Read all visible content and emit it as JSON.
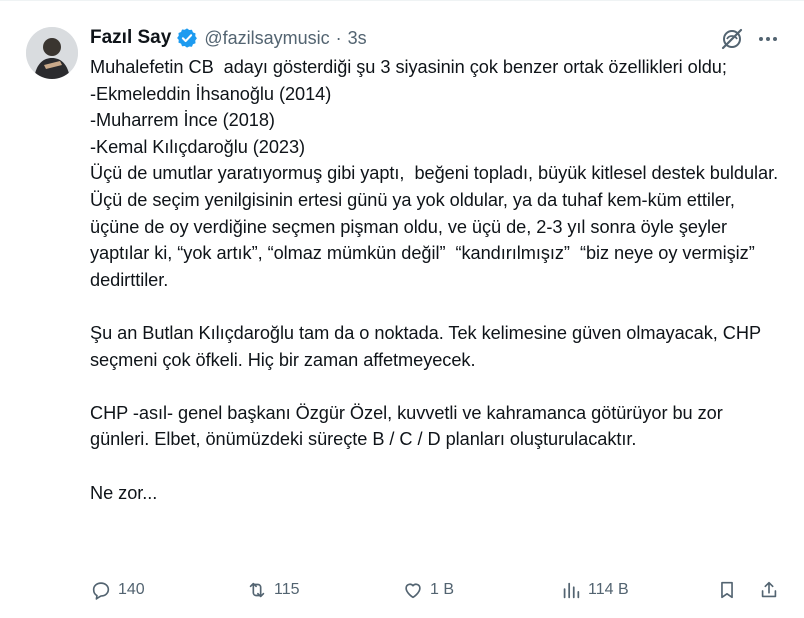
{
  "author": {
    "name": "Fazıl Say",
    "handle": "@fazilsaymusic",
    "separator": "·",
    "time": "3s"
  },
  "tweet_text": "Muhalefetin CB  adayı gösterdiği şu 3 siyasinin çok benzer ortak özellikleri oldu;\n-Ekmeleddin İhsanoğlu (2014)\n-Muharrem İnce (2018)\n-Kemal Kılıçdaroğlu (2023)\nÜçü de umutlar yaratıyormuş gibi yaptı,  beğeni topladı, büyük kitlesel destek buldular.\nÜçü de seçim yenilgisinin ertesi günü ya yok oldular, ya da tuhaf kem-küm ettiler, üçüne de oy verdiğine seçmen pişman oldu, ve üçü de, 2-3 yıl sonra öyle şeyler yaptılar ki, “yok artık”, “olmaz mümkün değil”  “kandırılmışız”  “biz neye oy vermişiz” dedirttiler.\n\nŞu an Butlan Kılıçdaroğlu tam da o noktada. Tek kelimesine güven olmayacak, CHP seçmeni çok öfkeli. Hiç bir zaman affetmeyecek.\n\nCHP -asıl- genel başkanı Özgür Özel, kuvvetli ve kahramanca götürüyor bu zor günleri. Elbet, önümüzdeki süreçte B / C / D planları oluşturulacaktır.\n\nNe zor...",
  "actions": {
    "replies": "140",
    "reposts": "115",
    "likes": "1 B",
    "views": "114 B"
  },
  "colors": {
    "verified": "#1d9bf0",
    "muted": "#536471",
    "text": "#0f1419"
  },
  "icons": [
    "verified-badge-icon",
    "grok-icon",
    "more-icon",
    "reply-icon",
    "repost-icon",
    "like-icon",
    "views-icon",
    "bookmark-icon",
    "share-icon"
  ]
}
